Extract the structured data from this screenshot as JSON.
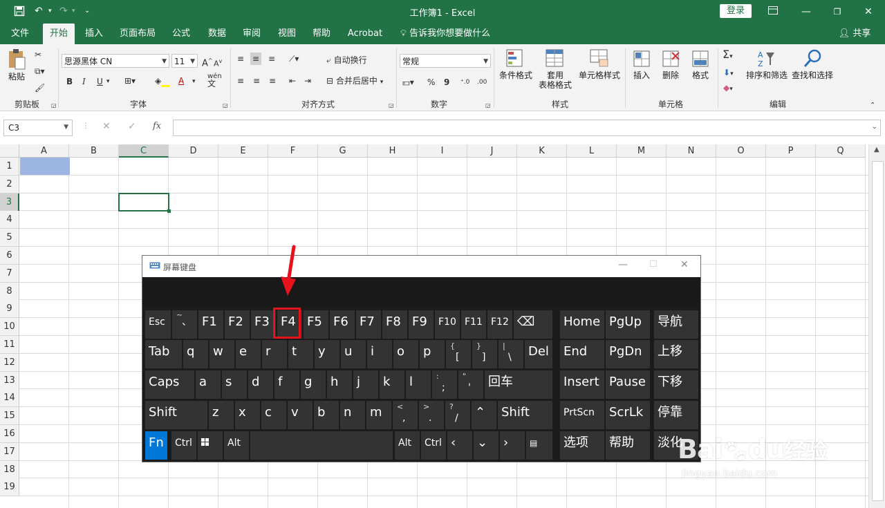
{
  "window": {
    "title": "工作簿1 - Excel",
    "login_label": "登录"
  },
  "ribbon_tabs": [
    "文件",
    "开始",
    "插入",
    "页面布局",
    "公式",
    "数据",
    "审阅",
    "视图",
    "帮助",
    "Acrobat"
  ],
  "tell_me": "告诉我你想要做什么",
  "share": "共享",
  "clipboard": {
    "paste": "粘贴",
    "group": "剪贴板"
  },
  "font": {
    "family": "思源黑体 CN",
    "size": "11",
    "bold": "B",
    "italic": "I",
    "underline": "U",
    "grow": "A",
    "shrink": "A",
    "wen": "wén",
    "wen2": "文",
    "group": "字体"
  },
  "alignment": {
    "wrap": "自动换行",
    "merge": "合并后居中",
    "group": "对齐方式"
  },
  "number": {
    "format": "常规",
    "percent": "%",
    "comma": "9",
    "group": "数字"
  },
  "styles": {
    "conditional": "条件格式",
    "table_line1": "套用",
    "table_line2": "表格格式",
    "cell_styles": "单元格样式",
    "group": "样式"
  },
  "cells": {
    "insert": "插入",
    "delete": "删除",
    "format": "格式",
    "group": "单元格"
  },
  "editing": {
    "sort": "排序和筛选",
    "find": "查找和选择",
    "group": "编辑"
  },
  "formula_bar": {
    "name_box": "C3",
    "fx": "fx",
    "value": ""
  },
  "columns": [
    "A",
    "B",
    "C",
    "D",
    "E",
    "F",
    "G",
    "H",
    "I",
    "J",
    "K",
    "L",
    "M",
    "N",
    "O",
    "P",
    "Q"
  ],
  "rows": [
    "1",
    "2",
    "3",
    "4",
    "5",
    "6",
    "7",
    "8",
    "9",
    "10",
    "11",
    "12",
    "13",
    "14",
    "15",
    "16",
    "17",
    "18",
    "19"
  ],
  "osk": {
    "title": "屏幕键盘",
    "row1": [
      "Esc",
      "~",
      "、",
      "F1",
      "F2",
      "F3",
      "F4",
      "F5",
      "F6",
      "F7",
      "F8",
      "F9",
      "F10",
      "F11",
      "F12"
    ],
    "row2": [
      "Tab",
      "q",
      "w",
      "e",
      "r",
      "t",
      "y",
      "u",
      "i",
      "o",
      "p",
      "{",
      "[",
      "}",
      "]",
      "|",
      "\\",
      "Del"
    ],
    "row3": [
      "Caps",
      "a",
      "s",
      "d",
      "f",
      "g",
      "h",
      "j",
      "k",
      "l",
      ":",
      ";",
      "\"",
      "'",
      "回车"
    ],
    "row4": [
      "Shift",
      "z",
      "x",
      "c",
      "v",
      "b",
      "n",
      "m",
      "<",
      ",",
      ">",
      ".",
      "?",
      "/",
      "Shift"
    ],
    "row5": [
      "Fn",
      "Ctrl",
      "Alt",
      "Alt",
      "Ctrl"
    ],
    "nav": [
      "Home",
      "PgUp",
      "导航",
      "End",
      "PgDn",
      "上移",
      "Insert",
      "Pause",
      "下移",
      "PrtScn",
      "ScrLk",
      "停靠",
      "选项",
      "帮助",
      "淡化"
    ]
  },
  "watermark": {
    "brand_a": "Bai",
    "brand_b": "du",
    "brand_c": "经验",
    "url": "jingyan.baidu.com"
  },
  "colors": {
    "excel_green": "#217346",
    "highlight_red": "#e8121e",
    "fn_blue": "#0078d7"
  }
}
